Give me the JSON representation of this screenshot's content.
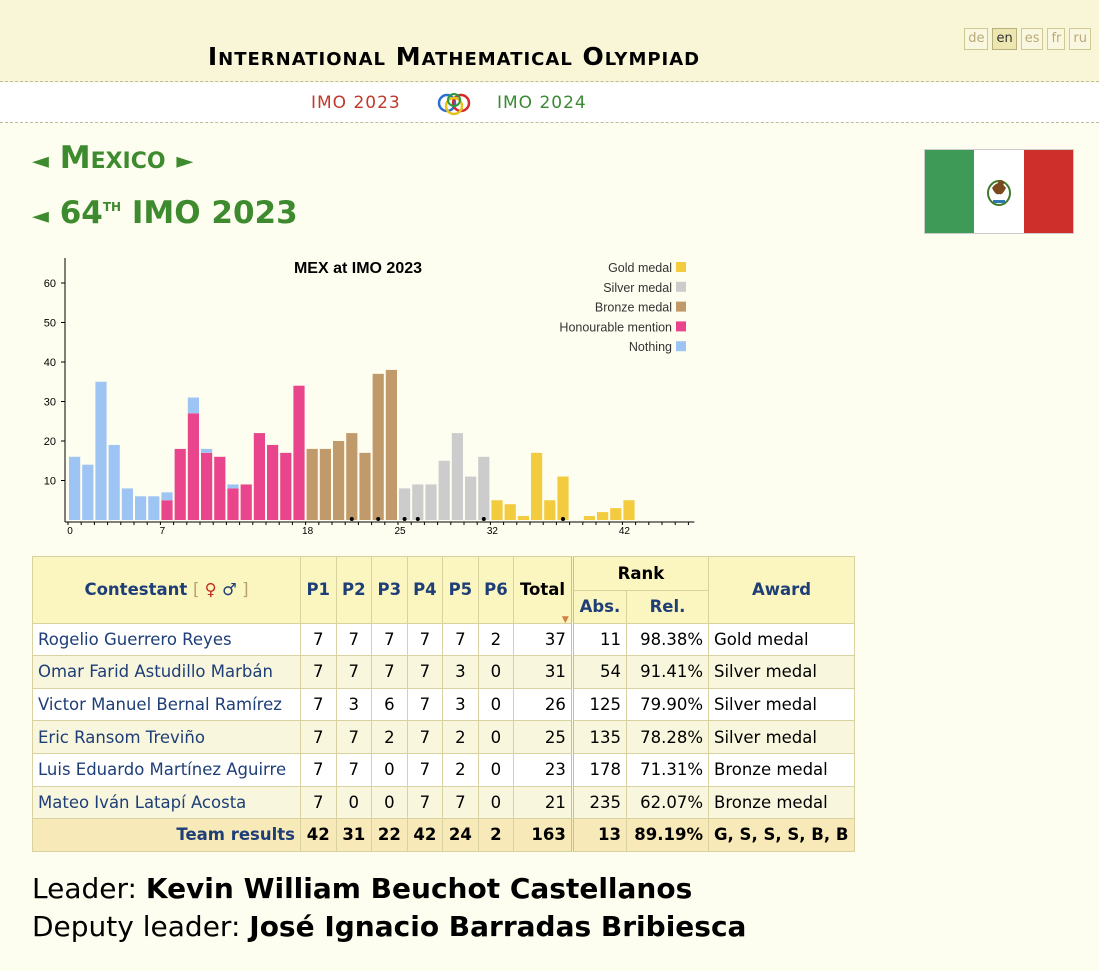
{
  "header": {
    "site_title": "International Mathematical Olympiad",
    "languages": [
      {
        "code": "de",
        "active": false
      },
      {
        "code": "en",
        "active": true
      },
      {
        "code": "es",
        "active": false
      },
      {
        "code": "fr",
        "active": false
      },
      {
        "code": "ru",
        "active": false
      }
    ]
  },
  "nav": {
    "prev": "IMO 2023",
    "next": "IMO 2024",
    "logo_icon": "imo-rings-logo-icon"
  },
  "country": {
    "name": "Mexico",
    "prev_arrow": "◄",
    "next_arrow": "►"
  },
  "edition": {
    "arrow": "◄",
    "number": "64",
    "suffix": "TH",
    "name": "IMO 2023"
  },
  "flag": {
    "icon": "mexico-flag-icon",
    "colors": [
      "#3e9a57",
      "#ffffff",
      "#ce2f2b"
    ]
  },
  "chart_data": {
    "type": "bar",
    "title": "MEX at IMO 2023",
    "ylim": [
      0,
      65
    ],
    "yticks": [
      10,
      20,
      30,
      40,
      50,
      60
    ],
    "xticks": [
      0,
      7,
      18,
      25,
      32,
      42
    ],
    "xlim": [
      0,
      47
    ],
    "legend_position": "top-right",
    "legend": [
      {
        "label": "Gold medal",
        "color": "#f2cb3e"
      },
      {
        "label": "Silver medal",
        "color": "#cccccc"
      },
      {
        "label": "Bronze medal",
        "color": "#c19a6b"
      },
      {
        "label": "Honourable mention",
        "color": "#e8458c"
      },
      {
        "label": "Nothing",
        "color": "#9ec4f3"
      }
    ],
    "bars": [
      {
        "score": 0,
        "nothing": 16
      },
      {
        "score": 1,
        "nothing": 14
      },
      {
        "score": 2,
        "nothing": 35
      },
      {
        "score": 3,
        "nothing": 19
      },
      {
        "score": 4,
        "nothing": 8
      },
      {
        "score": 5,
        "nothing": 6
      },
      {
        "score": 6,
        "nothing": 6
      },
      {
        "score": 7,
        "nothing": 2,
        "hm": 5
      },
      {
        "score": 8,
        "hm": 18
      },
      {
        "score": 9,
        "nothing": 4,
        "hm": 27
      },
      {
        "score": 10,
        "nothing": 1,
        "hm": 17
      },
      {
        "score": 11,
        "hm": 16
      },
      {
        "score": 12,
        "nothing": 1,
        "hm": 8
      },
      {
        "score": 13,
        "hm": 9
      },
      {
        "score": 14,
        "hm": 22
      },
      {
        "score": 15,
        "hm": 19
      },
      {
        "score": 16,
        "hm": 17
      },
      {
        "score": 17,
        "hm": 34
      },
      {
        "score": 18,
        "bronze": 18
      },
      {
        "score": 19,
        "bronze": 18
      },
      {
        "score": 20,
        "bronze": 20
      },
      {
        "score": 21,
        "bronze": 22
      },
      {
        "score": 22,
        "bronze": 17
      },
      {
        "score": 23,
        "bronze": 37
      },
      {
        "score": 24,
        "bronze": 38
      },
      {
        "score": 25,
        "silver": 8
      },
      {
        "score": 26,
        "silver": 9
      },
      {
        "score": 27,
        "silver": 9
      },
      {
        "score": 28,
        "silver": 15
      },
      {
        "score": 29,
        "silver": 22
      },
      {
        "score": 30,
        "silver": 11
      },
      {
        "score": 31,
        "silver": 16
      },
      {
        "score": 32,
        "gold": 5
      },
      {
        "score": 33,
        "gold": 4
      },
      {
        "score": 34,
        "gold": 1
      },
      {
        "score": 35,
        "gold": 17
      },
      {
        "score": 36,
        "gold": 5
      },
      {
        "score": 37,
        "gold": 11
      },
      {
        "score": 38,
        "gold": 0
      },
      {
        "score": 39,
        "gold": 1
      },
      {
        "score": 40,
        "gold": 2
      },
      {
        "score": 41,
        "gold": 3
      },
      {
        "score": 42,
        "gold": 5
      }
    ],
    "marked_scores": [
      21,
      23,
      25,
      26,
      31,
      37
    ]
  },
  "table": {
    "col_contestant": "Contestant",
    "gender_open": "[",
    "gender_female": "♀",
    "gender_male": "♂",
    "gender_close": "]",
    "problems": [
      "P1",
      "P2",
      "P3",
      "P4",
      "P5",
      "P6"
    ],
    "col_total": "Total",
    "col_rank": "Rank",
    "col_abs": "Abs.",
    "col_rel": "Rel.",
    "col_award": "Award",
    "sort_icon": "sort-triangle-icon",
    "rows": [
      {
        "name": "Rogelio Guerrero Reyes",
        "scores": [
          "7",
          "7",
          "7",
          "7",
          "7",
          "2"
        ],
        "total": "37",
        "abs": "11",
        "rel": "98.38%",
        "award": "Gold medal"
      },
      {
        "name": "Omar Farid Astudillo Marbán",
        "scores": [
          "7",
          "7",
          "7",
          "7",
          "3",
          "0"
        ],
        "total": "31",
        "abs": "54",
        "rel": "91.41%",
        "award": "Silver medal"
      },
      {
        "name": "Victor Manuel Bernal Ramírez",
        "scores": [
          "7",
          "3",
          "6",
          "7",
          "3",
          "0"
        ],
        "total": "26",
        "abs": "125",
        "rel": "79.90%",
        "award": "Silver medal"
      },
      {
        "name": "Eric Ransom Treviño",
        "scores": [
          "7",
          "7",
          "2",
          "7",
          "2",
          "0"
        ],
        "total": "25",
        "abs": "135",
        "rel": "78.28%",
        "award": "Silver medal"
      },
      {
        "name": "Luis Eduardo Martínez Aguirre",
        "scores": [
          "7",
          "7",
          "0",
          "7",
          "2",
          "0"
        ],
        "total": "23",
        "abs": "178",
        "rel": "71.31%",
        "award": "Bronze medal"
      },
      {
        "name": "Mateo Iván Latapí Acosta",
        "scores": [
          "7",
          "0",
          "0",
          "7",
          "7",
          "0"
        ],
        "total": "21",
        "abs": "235",
        "rel": "62.07%",
        "award": "Bronze medal"
      }
    ],
    "team": {
      "label": "Team results",
      "scores": [
        "42",
        "31",
        "22",
        "42",
        "24",
        "2"
      ],
      "total": "163",
      "abs": "13",
      "rel": "89.19%",
      "award": "G, S, S, S, B, B"
    }
  },
  "leaders": {
    "leader_label": "Leader:",
    "leader_name": "Kevin William Beuchot Castellanos",
    "deputy_label": "Deputy leader:",
    "deputy_name": "José Ignacio Barradas Bribiesca"
  }
}
